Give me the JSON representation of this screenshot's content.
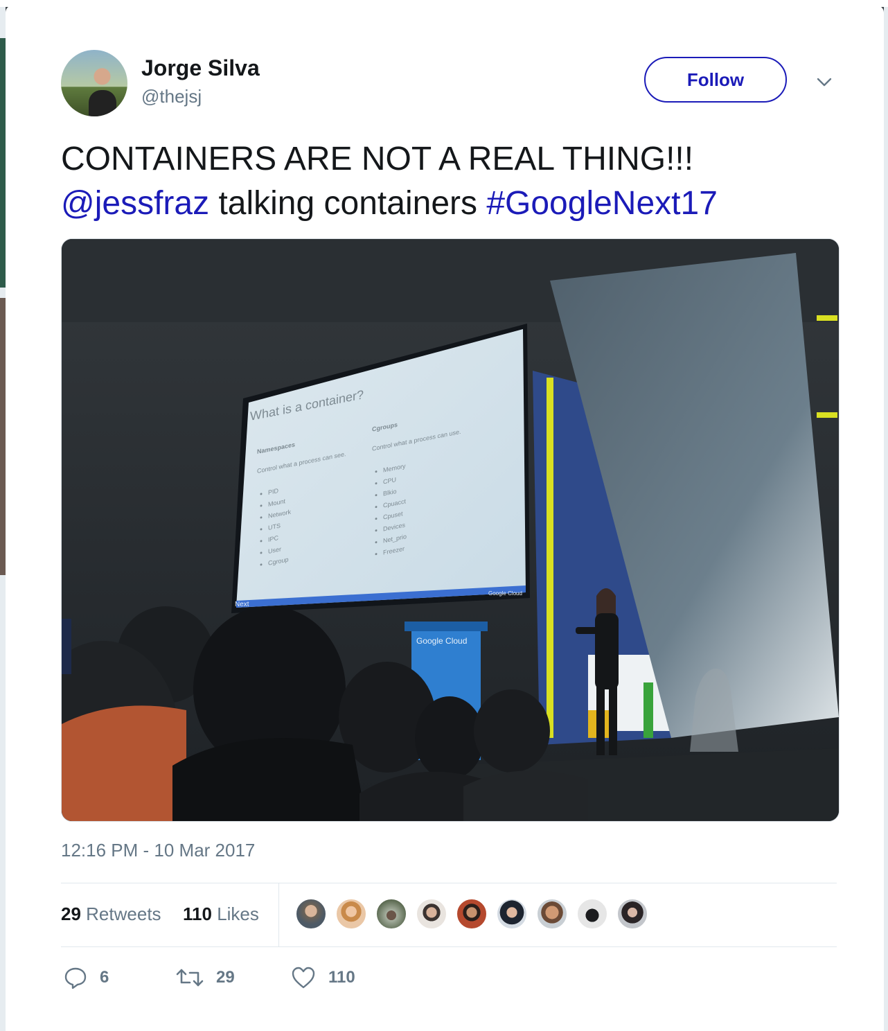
{
  "tweet": {
    "author_name": "Jorge Silva",
    "author_handle": "@thejsj",
    "follow_label": "Follow",
    "text_plain_1": "CONTAINERS ARE NOT A REAL THING!!!",
    "mention": "@jessfraz",
    "text_plain_2": " talking containers ",
    "hashtag": "#GoogleNext17",
    "timestamp": "12:16 PM - 10 Mar 2017"
  },
  "stats": {
    "retweets_count": "29",
    "retweets_label": "Retweets",
    "likes_count": "110",
    "likes_label": "Likes"
  },
  "actions": {
    "reply_count": "6",
    "retweet_count": "29",
    "like_count": "110"
  },
  "photo": {
    "slide_title": "What is a container?",
    "col1_heading": "Namespaces",
    "col1_sub": "Control what a process can see.",
    "col1_items": [
      "PID",
      "Mount",
      "Network",
      "UTS",
      "IPC",
      "User",
      "Cgroup"
    ],
    "col2_heading": "Cgroups",
    "col2_sub": "Control what a process can use.",
    "col2_items": [
      "Memory",
      "CPU",
      "Blkio",
      "Cpuacct",
      "Cpuset",
      "Devices",
      "Net_prio",
      "Freezer"
    ],
    "slide_footer_left": "Next",
    "slide_footer_right": "Google Cloud",
    "podium_label": "Google Cloud"
  },
  "colors": {
    "link": "#1b1bb8",
    "muted": "#657786",
    "text": "#14171a"
  },
  "icons": [
    "chevron-down-icon",
    "reply-icon",
    "retweet-icon",
    "heart-icon"
  ]
}
